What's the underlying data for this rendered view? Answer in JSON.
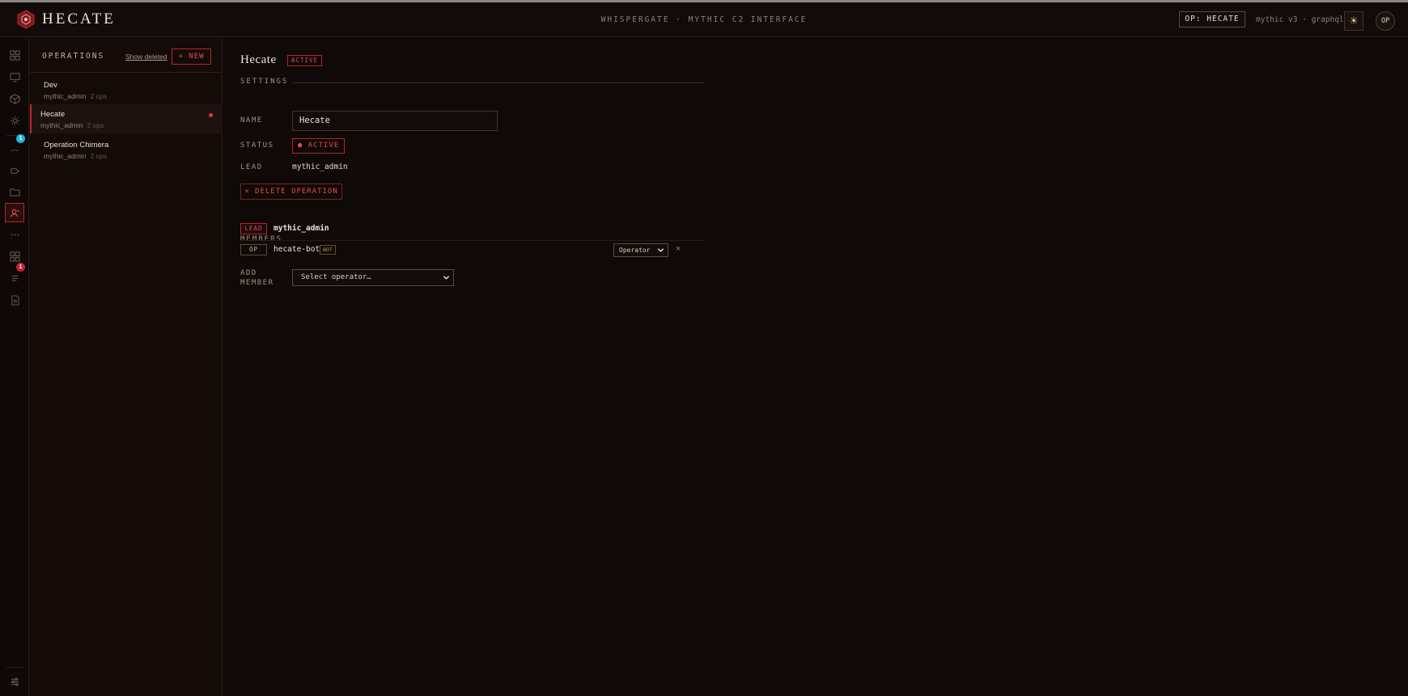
{
  "app": {
    "brand": "HECATE",
    "center_title": "WHISPERGATE · MYTHIC C2 INTERFACE",
    "op_chip": "OP: HECATE",
    "version": "mythic v3 · graphql",
    "theme_icon": "sun-icon",
    "avatar": "OP"
  },
  "rail": {
    "badges": {
      "second": "1",
      "third": "1"
    }
  },
  "operations_panel": {
    "title": "OPERATIONS",
    "show_deleted": "Show deleted",
    "new_label": "+ NEW",
    "items": [
      {
        "name": "Dev",
        "lead": "mythic_admin",
        "count": "2 ops"
      },
      {
        "name": "Hecate",
        "lead": "mythic_admin",
        "count": "2 ops"
      },
      {
        "name": "Operation Chimera",
        "lead": "mythic_admin",
        "count": "2 ops"
      }
    ]
  },
  "main": {
    "title": "Hecate",
    "title_badge": "ACTIVE",
    "settings_label": "SETTINGS",
    "name_label": "NAME",
    "name_value": "Hecate",
    "status_label": "STATUS",
    "status_value": "● ACTIVE",
    "lead_label": "LEAD",
    "lead_value": "mythic_admin",
    "delete_label": "✕ DELETE OPERATION",
    "members_label": "MEMBERS",
    "members": [
      {
        "role": "LEAD",
        "name": "mythic_admin"
      },
      {
        "role": "OP",
        "name": "hecate-bot",
        "tag": "BOT",
        "role_select": "Operator",
        "remove": "×"
      }
    ],
    "add_member_label_1": "ADD",
    "add_member_label_2": "MEMBER",
    "add_member_placeholder": "Select operator…"
  },
  "colors": {
    "accent": "#c0262e",
    "background": "#0f0907",
    "panel": "#140b08",
    "info_badge": "#25b3d8"
  }
}
